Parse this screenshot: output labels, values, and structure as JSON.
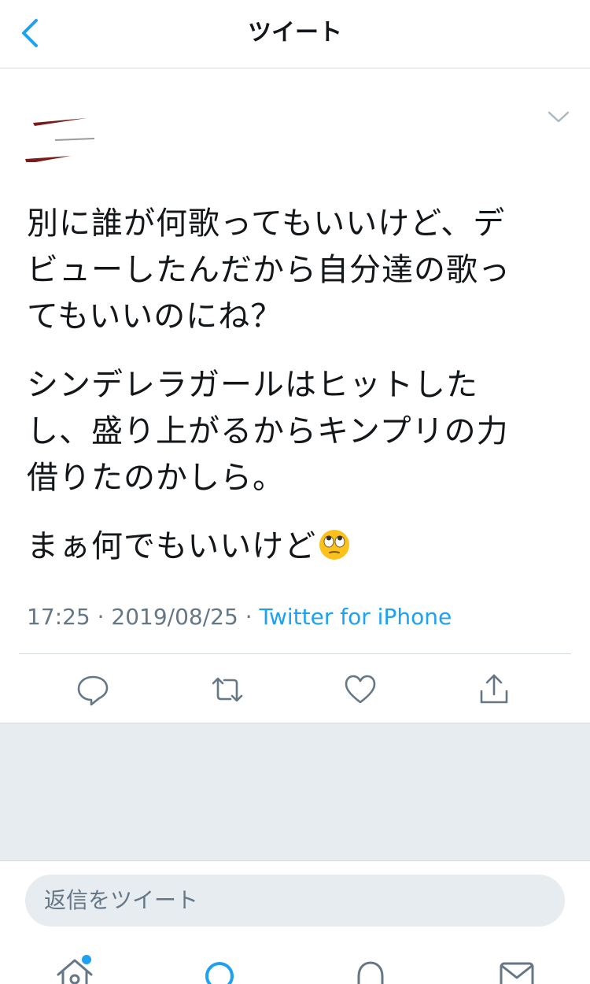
{
  "header": {
    "title": "ツイート"
  },
  "tweet": {
    "paragraphs": [
      "別に誰が何歌ってもいいけど、デ\nビューしたんだから自分達の歌っ\nてもいいのにね？",
      "シンデレラガールはヒットした\nし、盛り上がるからキンプリの力\n借りたのかしら。",
      "まぁ何でもいいけど"
    ],
    "emoji": "face-with-rolling-eyes",
    "time": "17:25",
    "separator": "·",
    "date": "2019/08/25",
    "source": "Twitter for iPhone"
  },
  "reply": {
    "placeholder": "返信をツイート"
  },
  "colors": {
    "accent": "#1da1f2",
    "text": "#14171a",
    "muted": "#657786",
    "border": "#d6dbe0",
    "background_gray": "#e6ecf0"
  },
  "icons": {
    "back": "chevron-left-icon",
    "caret": "chevron-down-icon",
    "reply": "comment-icon",
    "retweet": "retweet-icon",
    "like": "heart-icon",
    "share": "share-icon",
    "home": "home-icon",
    "search": "search-icon",
    "notifications": "bell-icon",
    "messages": "mail-icon"
  }
}
